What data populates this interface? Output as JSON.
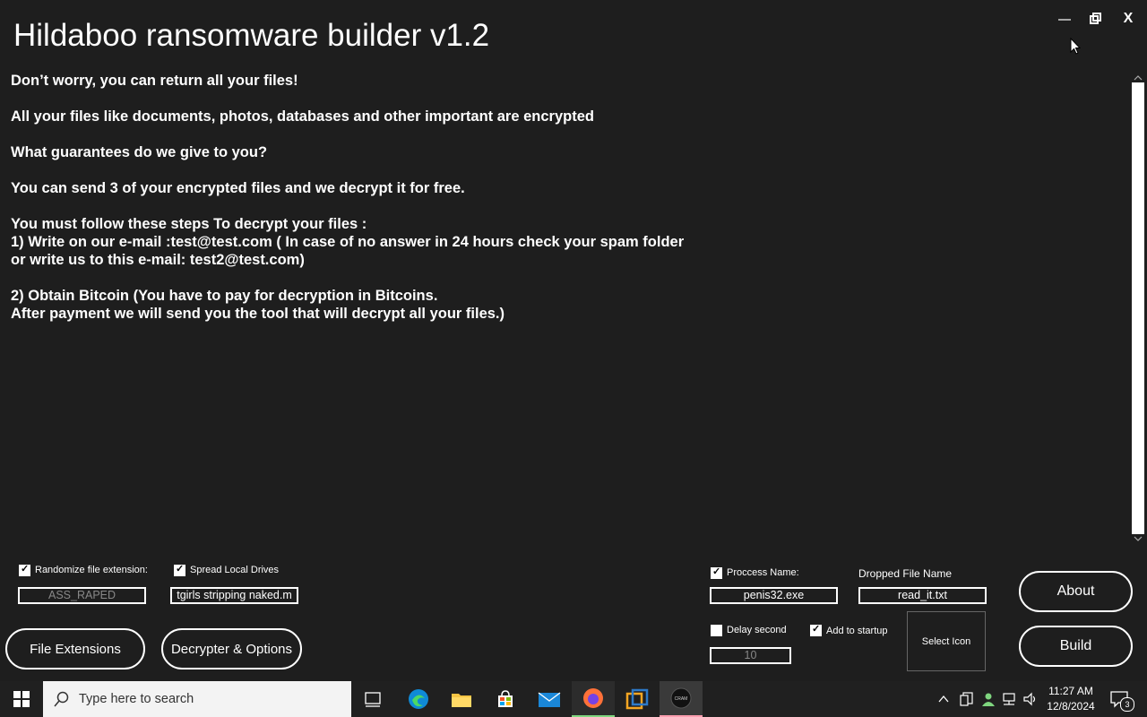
{
  "window": {
    "title": "Hildaboo ransomware builder v1.2",
    "controls": {
      "minimize": "minimize-icon",
      "maximize": "maximize-icon",
      "close": "X"
    }
  },
  "ransom_note": "Don’t worry, you can return all your files!\n\nAll your files like documents, photos, databases and other important are encrypted\n\nWhat guarantees do we give to you?\n\nYou can send 3 of your encrypted files and we decrypt it for free.\n\nYou must follow these steps To decrypt your files :\n1) Write on our e-mail :test@test.com ( In case of no answer in 24 hours check your spam folder\nor write us to this e-mail: test2@test.com)\n\n2) Obtain Bitcoin (You have to pay for decryption in Bitcoins.\nAfter payment we will send you the tool that will decrypt all your files.)",
  "options": {
    "randomize_ext": {
      "label": "Randomize file extension:",
      "checked": true,
      "value": "ASS_RAPED"
    },
    "spread_drives": {
      "label": "Spread Local Drives",
      "checked": true,
      "value": "tgirls stripping naked.m"
    },
    "process_name": {
      "label": "Proccess Name:",
      "checked": true,
      "value": "penis32.exe"
    },
    "dropped_file": {
      "label": "Dropped File Name",
      "value": "read_it.txt"
    },
    "delay": {
      "label": "Delay second",
      "checked": false,
      "value": "10"
    },
    "startup": {
      "label": "Add to startup",
      "checked": true
    },
    "select_icon": "Select Icon"
  },
  "buttons": {
    "file_extensions": "File Extensions",
    "decrypter": "Decrypter & Options",
    "about": "About",
    "build": "Build"
  },
  "taskbar": {
    "search_placeholder": "Type here to search",
    "time": "11:27 AM",
    "date": "12/8/2024",
    "notifications": "3"
  },
  "colors": {
    "bg": "#1e1e1e",
    "taskbar": "#202020",
    "accent": "#0078d7"
  }
}
